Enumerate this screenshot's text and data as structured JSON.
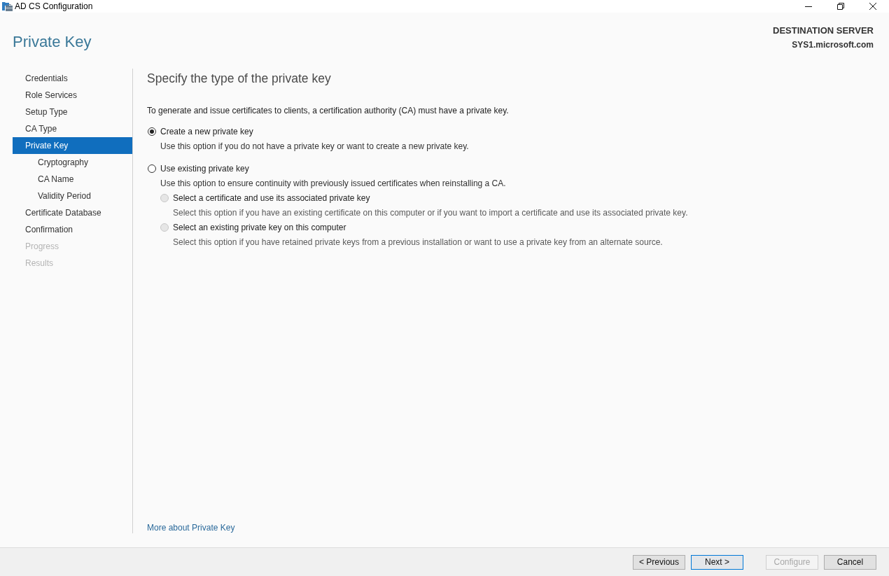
{
  "window": {
    "title": "AD CS Configuration"
  },
  "header": {
    "page_title": "Private Key",
    "destination_label": "DESTINATION SERVER",
    "destination_server": "SYS1.microsoft.com"
  },
  "sidebar": {
    "items": [
      {
        "label": "Credentials",
        "selected": false,
        "disabled": false
      },
      {
        "label": "Role Services",
        "selected": false,
        "disabled": false
      },
      {
        "label": "Setup Type",
        "selected": false,
        "disabled": false
      },
      {
        "label": "CA Type",
        "selected": false,
        "disabled": false
      },
      {
        "label": "Private Key",
        "selected": true,
        "disabled": false,
        "children": [
          {
            "label": "Cryptography",
            "selected": false,
            "disabled": false
          },
          {
            "label": "CA Name",
            "selected": false,
            "disabled": false
          },
          {
            "label": "Validity Period",
            "selected": false,
            "disabled": false
          }
        ]
      },
      {
        "label": "Certificate Database",
        "selected": false,
        "disabled": false
      },
      {
        "label": "Confirmation",
        "selected": false,
        "disabled": false
      },
      {
        "label": "Progress",
        "selected": false,
        "disabled": true
      },
      {
        "label": "Results",
        "selected": false,
        "disabled": true
      }
    ]
  },
  "content": {
    "heading": "Specify the type of the private key",
    "intro": "To generate and issue certificates to clients, a certification authority (CA) must have a private key.",
    "options": [
      {
        "label": "Create a new private key",
        "description": "Use this option if you do not have a private key or want to create a new private key.",
        "selected": true,
        "disabled": false
      },
      {
        "label": "Use existing private key",
        "description": "Use this option to ensure continuity with previously issued certificates when reinstalling a CA.",
        "selected": false,
        "disabled": false,
        "children": [
          {
            "label": "Select a certificate and use its associated private key",
            "description": "Select this option if you have an existing certificate on this computer or if you want to import a certificate and use its associated private key.",
            "selected": false,
            "disabled": true
          },
          {
            "label": "Select an existing private key on this computer",
            "description": "Select this option if you have retained private keys from a previous installation or want to use a private key from an alternate source.",
            "selected": false,
            "disabled": true
          }
        ]
      }
    ],
    "link": "More about Private Key"
  },
  "footer": {
    "navigation": [
      {
        "label": "< Previous",
        "focused": false,
        "disabled": false
      },
      {
        "label": "Next >",
        "focused": true,
        "disabled": false
      }
    ],
    "actions": [
      {
        "label": "Configure",
        "focused": false,
        "disabled": true
      },
      {
        "label": "Cancel",
        "focused": false,
        "disabled": false
      }
    ]
  }
}
